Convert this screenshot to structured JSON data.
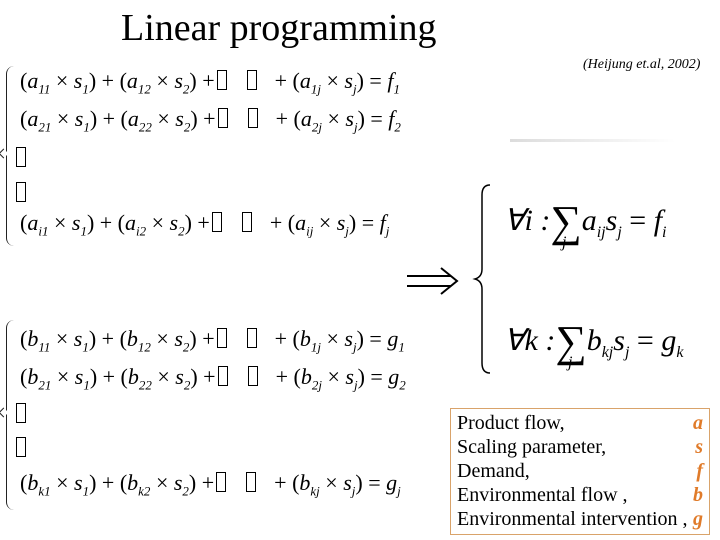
{
  "title": "Linear programming",
  "citation": "(Heijung et.al, 2002)",
  "system_a": {
    "rows": [
      {
        "coef": "a",
        "i": "11",
        "i2": "12",
        "ij": "1j",
        "rhs": "f",
        "rhs_idx": "1"
      },
      {
        "coef": "a",
        "i": "21",
        "i2": "22",
        "ij": "2j",
        "rhs": "f",
        "rhs_idx": "2"
      },
      {
        "coef": "a",
        "i": "i1",
        "i2": "i2",
        "ij": "ij",
        "rhs": "f",
        "rhs_idx": "j"
      }
    ]
  },
  "system_b": {
    "rows": [
      {
        "coef": "b",
        "i": "11",
        "i2": "12",
        "ij": "1j",
        "rhs": "g",
        "rhs_idx": "1"
      },
      {
        "coef": "b",
        "i": "21",
        "i2": "22",
        "ij": "2j",
        "rhs": "g",
        "rhs_idx": "2"
      },
      {
        "coef": "b",
        "i": "k1",
        "i2": "k2",
        "ij": "kj",
        "rhs": "g",
        "rhs_idx": "j"
      }
    ]
  },
  "variable": "s",
  "summary": {
    "eq1": {
      "quant": "∀i :",
      "coef": "a",
      "coef_idx": "ij",
      "var": "s",
      "var_idx": "j",
      "rhs": "f",
      "rhs_idx": "i",
      "sum_idx": "j"
    },
    "eq2": {
      "quant": "∀k :",
      "coef": "b",
      "coef_idx": "kj",
      "var": "s",
      "var_idx": "j",
      "rhs": "g",
      "rhs_idx": "k",
      "sum_idx": "j"
    }
  },
  "legend": {
    "border_color": "#d9a36a",
    "symbol_color": "#e07b2a",
    "items": [
      {
        "label": "Product flow,",
        "symbol": "a"
      },
      {
        "label": "Scaling parameter,",
        "symbol": "s"
      },
      {
        "label": "Demand,",
        "symbol": "f"
      },
      {
        "label": "Environmental flow ,",
        "symbol": "b"
      },
      {
        "label": "Environmental intervention ,",
        "symbol": "g"
      }
    ]
  }
}
